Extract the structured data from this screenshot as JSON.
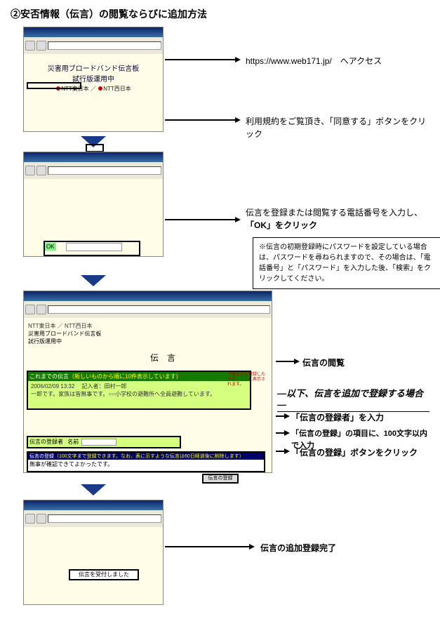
{
  "title": "②安否情報（伝言）の閲覧ならびに追加方法",
  "step1": {
    "url_text": "https://www.web171.jp/",
    "url_suffix": "へアクセス",
    "body_title1": "災害用ブロードバンド伝言板",
    "body_title2": "試行版運用中",
    "ntt_east": "NTT東日本",
    "ntt_west": "NTT西日本",
    "agree_text": "利用規約をご覧頂き、「同意する」ボタンをクリック"
  },
  "step2": {
    "ok_label": "OK",
    "desc_line1": "伝言を登録または閲覧する電話番号を入力し、",
    "desc_line2": "「OK」をクリック",
    "note": "※伝言の初期登録時にパスワードを設定している場合は、パスワードを尋ねられますので、その場合は、「電話番号」と「パスワード」を入力した後、「検索」をクリックしてください。"
  },
  "step3": {
    "header_ntt": "NTT東日本 ／ NTT西日本",
    "header_sub1": "災害用ブロードバンド伝言板",
    "header_sub2": "試行版運用中",
    "dengon_title": "伝　言",
    "greenbar_title": "これまでの伝言",
    "greenbar_title_note": "（新しいものから順に10件表示しています）",
    "greenbar_date": "2006/02/09 13:32",
    "greenbar_name_label": "記入者：",
    "greenbar_name": "田村一郎",
    "greenbar_msg": "一郎です。家族は皆無事です。○○小学校の避難所へ全員避難しています。",
    "right_note": "今後も言を登録した方が、ここに表示されます。",
    "reg_label": "伝言の登録者",
    "reg_name_lbl": "名前",
    "bluebar_title": "伝言の登録",
    "bluebar_note": "（100文字まで登録できます。なお、表に示すような伝言は60日経過後に削除します）",
    "bluebar_content": "無事が確認できてよかったです。",
    "btn_label": "伝言の登録",
    "desc_view": "伝言の閲覧",
    "mid_label": "―以下、伝言を追加で登録する場合―",
    "desc_reg": "「伝言の登録者」を入力",
    "desc_input": "「伝言の登録」の項目に、100文字以内で入力",
    "desc_btn": "「伝言の登録」ボタンをクリック"
  },
  "step4": {
    "msg": "伝言を受付しました",
    "desc": "伝言の追加登録完了"
  }
}
